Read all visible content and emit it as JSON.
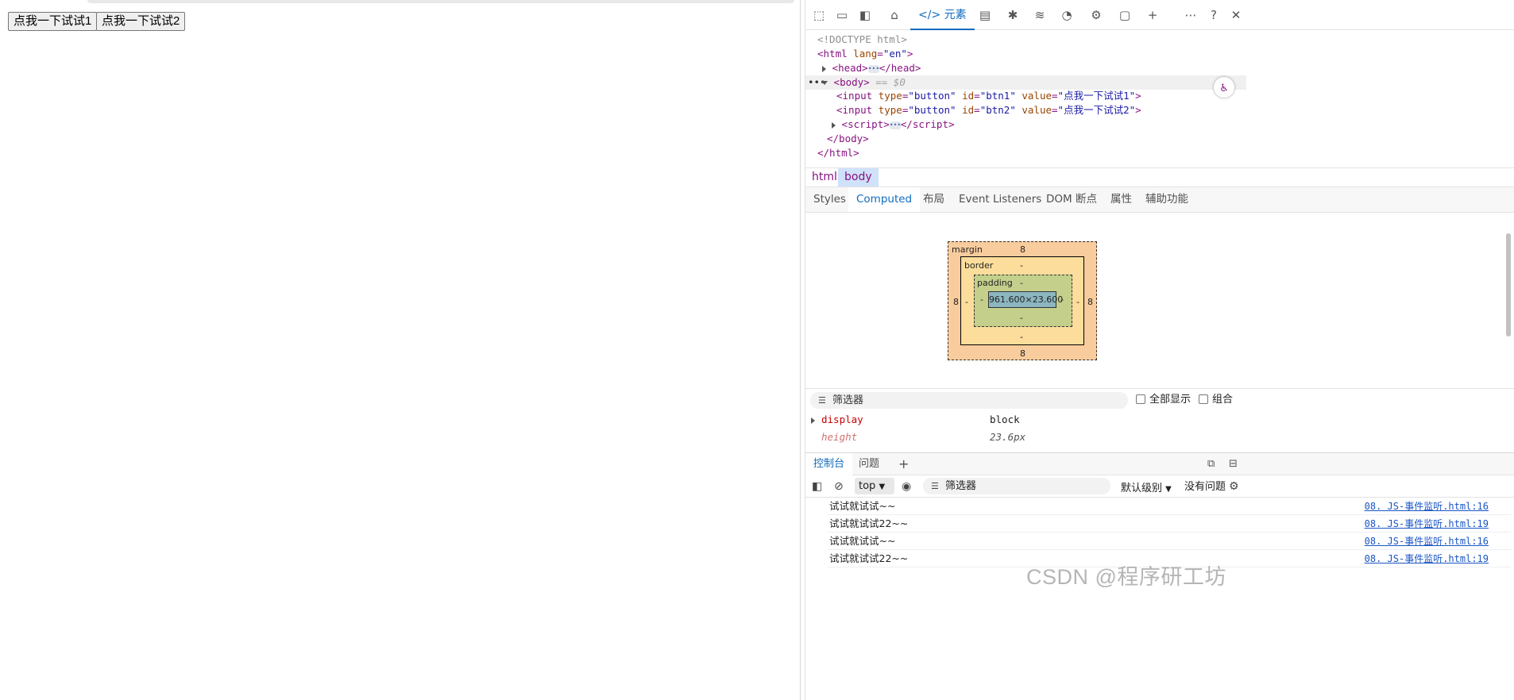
{
  "page": {
    "buttons": [
      {
        "label": "点我一下试试1"
      },
      {
        "label": "点我一下试试2"
      }
    ]
  },
  "devtools": {
    "toolbar": {
      "elements_tab": "元素",
      "icons": [
        "inspect-icon",
        "device-icon",
        "dock-icon",
        "home-icon",
        "elements-icon",
        "console-icon",
        "bug-icon",
        "network-icon",
        "performance-icon",
        "settings-gear-icon",
        "application-icon",
        "add-icon",
        "more-icon",
        "help-icon",
        "close-icon"
      ]
    },
    "tree": {
      "doctype": "<!DOCTYPE html>",
      "html_open_tag": "html",
      "html_attr": "lang",
      "html_attr_val": "\"en\"",
      "head": "head",
      "body": "body",
      "body_marker": "== $0",
      "input1": {
        "tag": "input",
        "a1": "type",
        "v1": "\"button\"",
        "a2": "id",
        "v2": "\"btn1\"",
        "a3": "value",
        "v3": "\"点我一下试试1\""
      },
      "input2": {
        "tag": "input",
        "a1": "type",
        "v1": "\"button\"",
        "a2": "id",
        "v2": "\"btn2\"",
        "a3": "value",
        "v3": "\"点我一下试试2\""
      },
      "script": "script",
      "body_close": "</body>",
      "html_close": "</html>"
    },
    "breadcrumbs": [
      "html",
      "body"
    ],
    "subtabs": [
      "Styles",
      "Computed",
      "布局",
      "Event Listeners",
      "DOM 断点",
      "属性",
      "辅助功能"
    ],
    "box_model": {
      "margin_label": "margin",
      "border_label": "border",
      "padding_label": "padding",
      "margin_top": "8",
      "margin_right": "8",
      "margin_bottom": "8",
      "margin_left": "8",
      "border_top": "-",
      "border_right": "-",
      "border_bottom": "-",
      "border_left": "-",
      "padding_top": "-",
      "padding_right": "-",
      "padding_bottom": "-",
      "padding_left": "-",
      "content": "961.600×23.600"
    },
    "filter": {
      "placeholder": "筛选器",
      "show_all": "全部显示",
      "group": "组合"
    },
    "properties": [
      {
        "name": "display",
        "value": "block"
      },
      {
        "name": "height",
        "value": "23.6px"
      }
    ],
    "console": {
      "tabs": [
        "控制台",
        "问题"
      ],
      "context": "top",
      "filter": "筛选器",
      "level": "默认级别",
      "issues": "没有问题",
      "logs": [
        {
          "msg": "试试就试试~~",
          "src": "08. JS-事件监听.html:16"
        },
        {
          "msg": "试试就试试22~~",
          "src": "08. JS-事件监听.html:19"
        },
        {
          "msg": "试试就试试~~",
          "src": "08. JS-事件监听.html:16"
        },
        {
          "msg": "试试就试试22~~",
          "src": "08. JS-事件监听.html:19"
        }
      ]
    }
  },
  "watermark": "CSDN @程序研工坊"
}
